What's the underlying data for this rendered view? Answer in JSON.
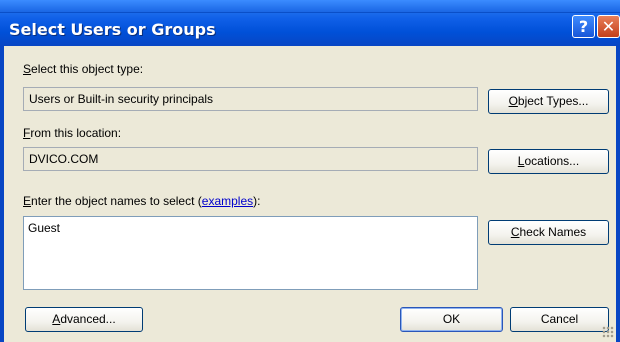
{
  "window": {
    "title": "Select Users or Groups",
    "help_glyph": "?",
    "close_glyph": "✕"
  },
  "object_type": {
    "label_accel": "S",
    "label_rest": "elect this object type:",
    "value": "Users or Built-in security principals",
    "button_accel": "O",
    "button_rest": "bject Types..."
  },
  "location": {
    "label_accel": "F",
    "label_rest": "rom this location:",
    "value": "DVICO.COM",
    "button_accel": "L",
    "button_rest": "ocations..."
  },
  "names": {
    "label_accel": "E",
    "label_rest": "nter the object names to select (",
    "link_text": "examples",
    "label_end": "):",
    "value": "Guest",
    "check_accel": "C",
    "check_rest": "heck Names"
  },
  "footer": {
    "advanced_accel": "A",
    "advanced_rest": "dvanced...",
    "ok_label": "OK",
    "cancel_label": "Cancel"
  },
  "colors": {
    "titlebar": "#0846c4",
    "dialog_bg": "#ece9d8",
    "link": "#0000cc"
  }
}
